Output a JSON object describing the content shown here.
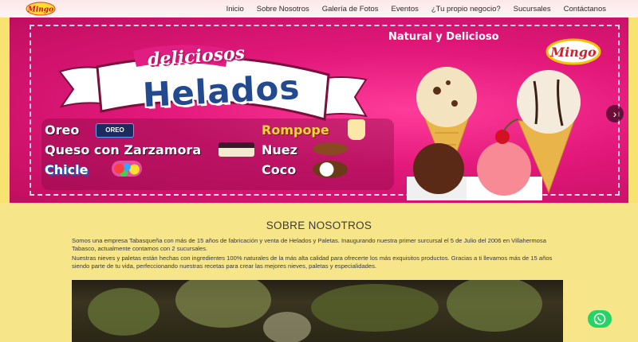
{
  "nav": {
    "logo_text": "Mingo",
    "links": [
      "Inicio",
      "Sobre Nosotros",
      "Galería de Fotos",
      "Eventos",
      "¿Tu propio negocio?",
      "Sucursales",
      "Contáctanos"
    ]
  },
  "hero": {
    "tagline": "Natural y Delicioso",
    "word_top": "deliciosos",
    "word_main": "Helados",
    "brand_text": "Mingo",
    "flavors": {
      "oreo": "Oreo",
      "queso": "Queso con Zarzamora",
      "chicle": "Chicle",
      "rompope": "Rompope",
      "nuez": "Nuez",
      "coco": "Coco"
    },
    "oreo_thumb_text": "OREO"
  },
  "about": {
    "title": "SOBRE NOSOTROS",
    "p1": "Somos una empresa Tabasqueña con más de 15 años de fabricación y venta de Helados y Paletas. Inaugurando nuestra primer surcursal el 5 de Julio del 2006 en Villahermosa Tabasco, actualmente contamos con 2 sucursales.",
    "p2": "Nuestras nieves y paletas están hechas con ingredientes 100% naturales de la más alta calidad para ofrecerte los más exquisitos productos. Gracias a ti llevamos más de 15 años siendo parte de tu vida, perfeccionando nuestras recetas para crear las mejores nieves, paletas y especialidades."
  },
  "colors": {
    "page_bg": "#f7e58a",
    "hero_pink": "#e2187a",
    "helados_blue": "#234a8f",
    "whatsapp_green": "#25d366"
  },
  "icons": {
    "slider_next": "chevron-right-icon",
    "whatsapp": "whatsapp-icon"
  }
}
